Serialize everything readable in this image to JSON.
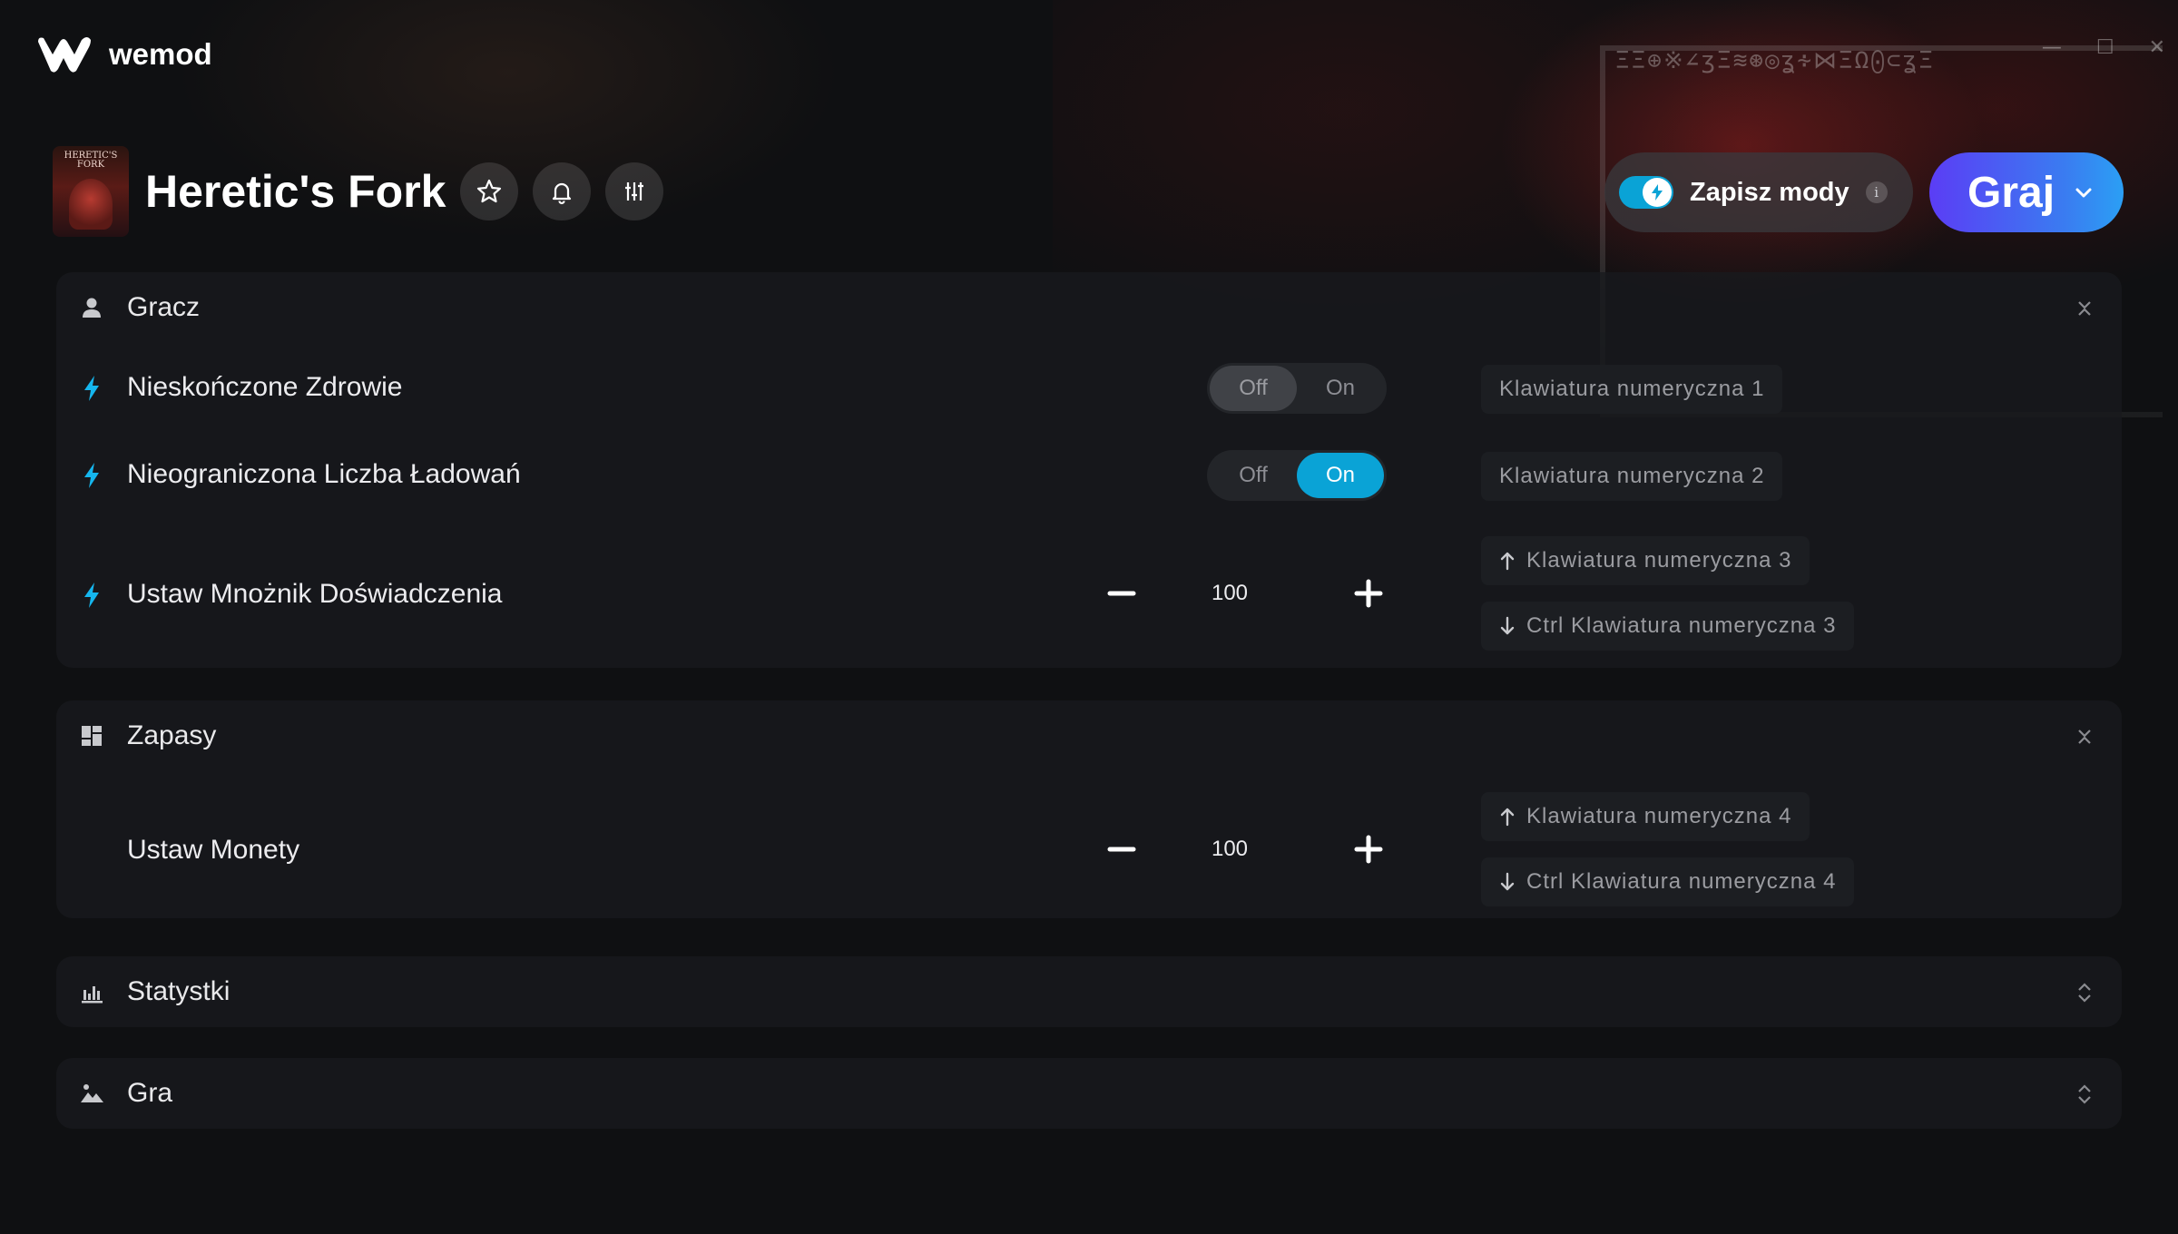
{
  "app": {
    "name": "wemod"
  },
  "window": {
    "controls": [
      "minimize-icon",
      "maximize-icon",
      "close-icon"
    ]
  },
  "game": {
    "title": "Heretic's Fork",
    "thumbnail_text": "HERETIC'S FORK",
    "header_buttons": [
      "star-icon",
      "bell-icon",
      "sliders-icon"
    ]
  },
  "save_mods": {
    "label": "Zapisz mody",
    "info": "i",
    "enabled": true
  },
  "play": {
    "label": "Graj"
  },
  "colors": {
    "accent": "#0aa3d6",
    "play_start": "#5b3df5",
    "play_end": "#2b9ff4"
  },
  "sections": {
    "player": {
      "title": "Gracz",
      "icon": "person-icon",
      "mods": [
        {
          "label": "Nieskończone Zdrowie",
          "off": "Off",
          "on": "On",
          "state": "Off",
          "hotkey": "Klawiatura numeryczna 1"
        },
        {
          "label": "Nieograniczona Liczba Ładowań",
          "off": "Off",
          "on": "On",
          "state": "On",
          "hotkey": "Klawiatura numeryczna 2"
        },
        {
          "label": "Ustaw Mnożnik Doświadczenia",
          "value": "100",
          "hotkey_up": "Klawiatura numeryczna 3",
          "hotkey_down": "Ctrl Klawiatura numeryczna 3"
        }
      ]
    },
    "supplies": {
      "title": "Zapasy",
      "icon": "dashboard-icon",
      "mods": [
        {
          "label": "Ustaw Monety",
          "value": "100",
          "hotkey_up": "Klawiatura numeryczna 4",
          "hotkey_down": "Ctrl Klawiatura numeryczna 4"
        }
      ]
    },
    "stats": {
      "title": "Statystki",
      "icon": "bar-chart-icon"
    },
    "game": {
      "title": "Gra",
      "icon": "landscape-icon"
    }
  }
}
